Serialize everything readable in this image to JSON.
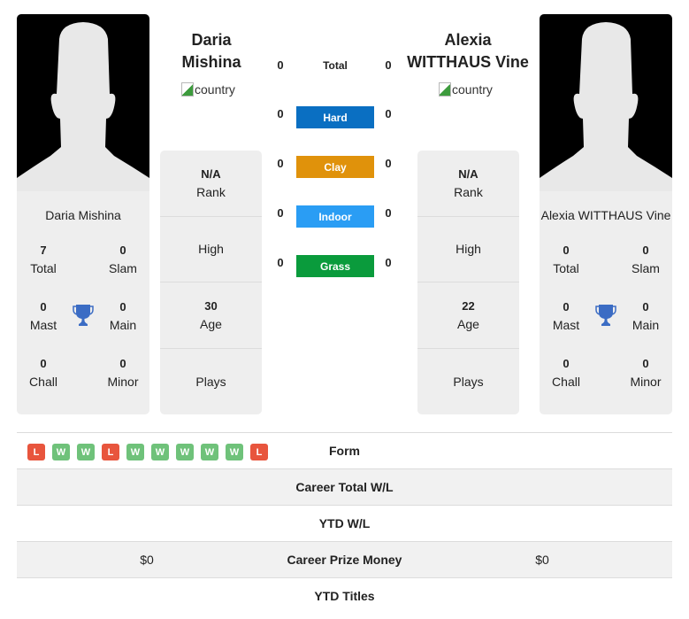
{
  "colors": {
    "hard": "#0a6fc2",
    "clay": "#e0920b",
    "indoor": "#2a9df4",
    "grass": "#0a9b3c",
    "win": "#6fc27a",
    "loss": "#e8553d",
    "trophy": "#3b6cc4"
  },
  "player_left": {
    "name_line1": "Daria",
    "name_line2": "Mishina",
    "full_name": "Daria Mishina",
    "country_alt": "country",
    "rank": "N/A",
    "rank_label": "Rank",
    "high_label": "High",
    "age": "30",
    "age_label": "Age",
    "plays_label": "Plays",
    "titles": {
      "total": "7",
      "total_label": "Total",
      "slam": "0",
      "slam_label": "Slam",
      "mast": "0",
      "mast_label": "Mast",
      "main": "0",
      "main_label": "Main",
      "chall": "0",
      "chall_label": "Chall",
      "minor": "0",
      "minor_label": "Minor"
    }
  },
  "player_right": {
    "name_line1": "Alexia",
    "name_line2": "WITTHAUS Vine",
    "full_name": "Alexia WITTHAUS Vine",
    "country_alt": "country",
    "rank": "N/A",
    "rank_label": "Rank",
    "high_label": "High",
    "age": "22",
    "age_label": "Age",
    "plays_label": "Plays",
    "titles": {
      "total": "0",
      "total_label": "Total",
      "slam": "0",
      "slam_label": "Slam",
      "mast": "0",
      "mast_label": "Mast",
      "main": "0",
      "main_label": "Main",
      "chall": "0",
      "chall_label": "Chall",
      "minor": "0",
      "minor_label": "Minor"
    }
  },
  "h2h": [
    {
      "label": "Total",
      "left": "0",
      "right": "0",
      "surface": "total"
    },
    {
      "label": "Hard",
      "left": "0",
      "right": "0",
      "surface": "hard"
    },
    {
      "label": "Clay",
      "left": "0",
      "right": "0",
      "surface": "clay"
    },
    {
      "label": "Indoor",
      "left": "0",
      "right": "0",
      "surface": "indoor"
    },
    {
      "label": "Grass",
      "left": "0",
      "right": "0",
      "surface": "grass"
    }
  ],
  "form_left": [
    "L",
    "W",
    "W",
    "L",
    "W",
    "W",
    "W",
    "W",
    "W",
    "L"
  ],
  "stats": [
    {
      "label": "Form",
      "left": "",
      "right": ""
    },
    {
      "label": "Career Total W/L",
      "left": "",
      "right": ""
    },
    {
      "label": "YTD W/L",
      "left": "",
      "right": ""
    },
    {
      "label": "Career Prize Money",
      "left": "$0",
      "right": "$0"
    },
    {
      "label": "YTD Titles",
      "left": "",
      "right": ""
    }
  ]
}
